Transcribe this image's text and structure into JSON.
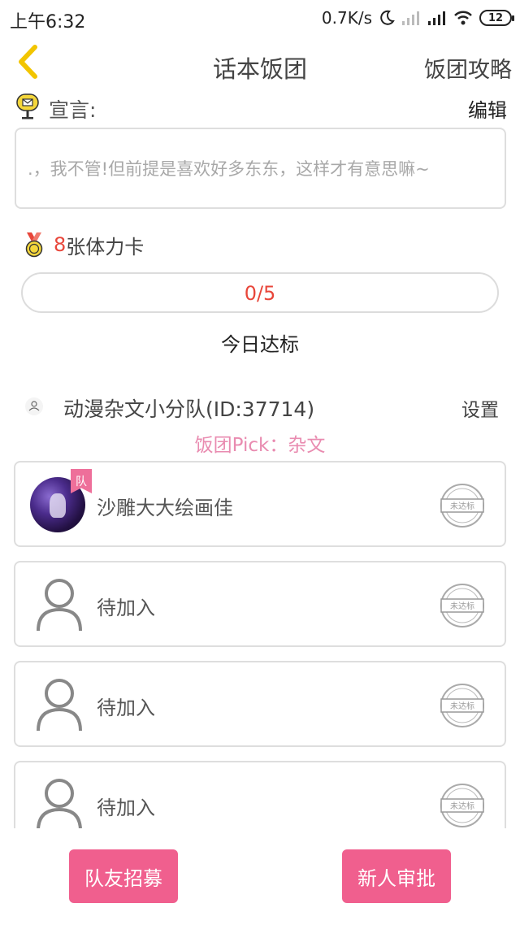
{
  "status_bar": {
    "time": "上午6:32",
    "net_speed": "0.7K/s",
    "battery": "12"
  },
  "header": {
    "title": "话本饭团",
    "guide_label": "饭团攻略"
  },
  "declaration": {
    "label": "宣言:",
    "edit_label": "编辑",
    "text": ".，我不管!但前提是喜欢好多东东，这样才有意思嘛~"
  },
  "stamina": {
    "count": "8",
    "label": "张体力卡"
  },
  "progress": {
    "text": "0/5",
    "value": 0,
    "max": 5,
    "caption": "今日达标"
  },
  "team": {
    "name": "动漫杂文小分队(ID:37714)",
    "settings_label": "设置",
    "pick_label": "饭团Pick：",
    "pick_value": "杂文"
  },
  "members": [
    {
      "name": "沙雕大大绘画佳",
      "badge": "队",
      "stamp": "未达标"
    },
    {
      "name": "待加入",
      "stamp": "未达标"
    },
    {
      "name": "待加入",
      "stamp": "未达标"
    },
    {
      "name": "待加入",
      "stamp": "未达标"
    }
  ],
  "buttons": {
    "recruit": "队友招募",
    "approve": "新人审批"
  },
  "colors": {
    "accent_pink": "#f05f8e",
    "pick_pink": "#e98bb0",
    "highlight_red": "#e8463a"
  }
}
